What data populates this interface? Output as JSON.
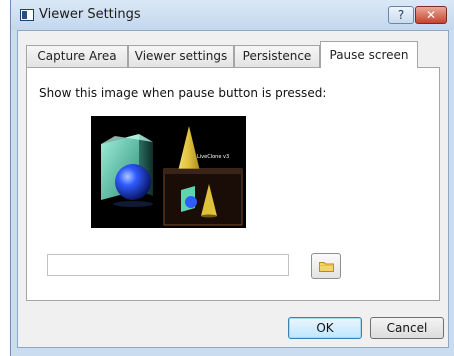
{
  "window": {
    "title": "Viewer Settings",
    "help_label": "?",
    "close_label": "✕"
  },
  "tabs": [
    {
      "label": "Capture Area",
      "active": false
    },
    {
      "label": "Viewer settings",
      "active": false
    },
    {
      "label": "Persistence",
      "active": false
    },
    {
      "label": "Pause screen",
      "active": true
    }
  ],
  "pause_screen": {
    "prompt": "Show this image when pause button is pressed:",
    "preview_caption": "LiveClone v3",
    "path_value": ""
  },
  "buttons": {
    "ok": "OK",
    "cancel": "Cancel"
  },
  "colors": {
    "accent": "#3c7fb1",
    "close": "#c7432c",
    "folder": "#e8c34a"
  }
}
